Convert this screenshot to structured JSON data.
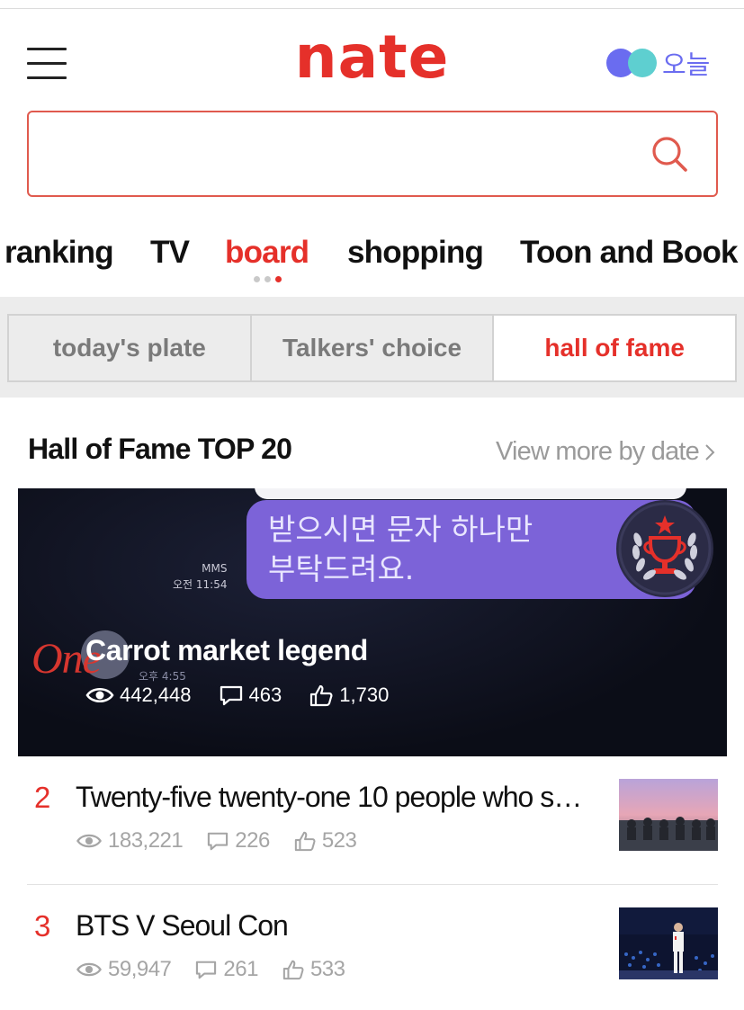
{
  "header": {
    "logo": "nate",
    "today_label": "오늘",
    "brand_color": "#e5302a"
  },
  "search": {
    "placeholder": "",
    "value": ""
  },
  "nav": {
    "items": [
      "ranking",
      "TV",
      "board",
      "shopping",
      "Toon and Book"
    ],
    "active": "board"
  },
  "tabs": {
    "items": [
      "today's plate",
      "Talkers' choice",
      "hall of fame"
    ],
    "active": "hall of fame"
  },
  "section": {
    "title": "Hall of Fame TOP 20",
    "view_more": "View more by date"
  },
  "featured": {
    "rank": "One",
    "title": "Carrot market legend",
    "views": "442,448",
    "comments": "463",
    "likes": "1,730",
    "image_text_line1": "받으시면 문자 하나만",
    "image_text_line2": "부탁드려요.",
    "image_meta_type": "MMS",
    "image_meta_time": "오전 11:54",
    "image_meta_time2": "오후 4:55"
  },
  "list": [
    {
      "rank": "2",
      "title": "Twenty-five twenty-one 10 people who s…",
      "views": "183,221",
      "comments": "226",
      "likes": "523"
    },
    {
      "rank": "3",
      "title": "BTS V Seoul Con",
      "views": "59,947",
      "comments": "261",
      "likes": "533"
    }
  ]
}
